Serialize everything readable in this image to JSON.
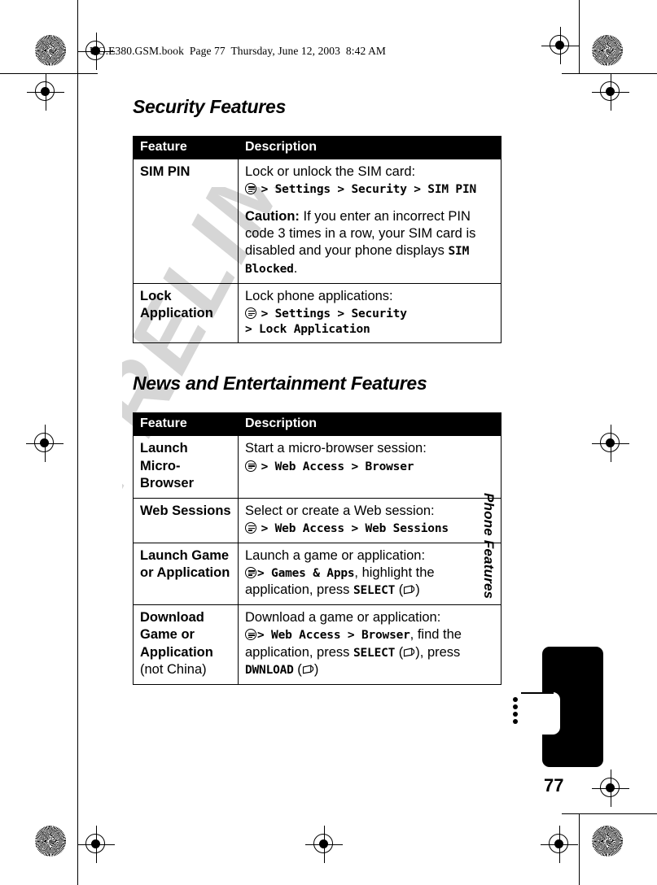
{
  "document": {
    "file_info": "UG.E380.GSM.book  Page 77  Thursday, June 12, 2003  8:42 AM",
    "watermark": "PRELIMINARY",
    "page_number": "77",
    "chapter_tab": "Phone Features"
  },
  "sections": [
    {
      "heading": "Security Features",
      "table": {
        "columns": [
          "Feature",
          "Description"
        ],
        "rows": [
          {
            "feature": "SIM PIN",
            "description_line1": "Lock or unlock the SIM card:",
            "path": "> Settings > Security > SIM PIN",
            "note_label": "Caution:",
            "note_text": " If you enter an incorrect PIN code 3 times in a row, your SIM card is disabled and your phone displays ",
            "note_mono": "SIM Blocked",
            "note_tail": "."
          },
          {
            "feature": "Lock Application",
            "description_line1": "Lock phone applications:",
            "path": "> Settings > Security",
            "path2": "> Lock Application"
          }
        ]
      }
    },
    {
      "heading": "News and Entertainment Features",
      "table": {
        "columns": [
          "Feature",
          "Description"
        ],
        "rows": [
          {
            "feature": "Launch Micro-Browser",
            "description_line1": "Start a micro-browser session:",
            "path": "> Web Access > Browser"
          },
          {
            "feature": "Web Sessions",
            "description_line1": "Select or create a Web session:",
            "path": "> Web Access > Web Sessions"
          },
          {
            "feature": "Launch Game or Application",
            "description_line1": "Launch a game or application:",
            "path": "> Games & Apps",
            "path_tail": ", highlight the application, press ",
            "key_label": "SELECT",
            "key_close": ")"
          },
          {
            "feature": "Download Game or Application",
            "feature_note": "(not China)",
            "description_line1": "Download a game or application:",
            "path": "> Web Access > Browser",
            "path_tail": ", find the application, press ",
            "key_label": "SELECT",
            "key_mid": "), press ",
            "key_label2": "DWNLOAD",
            "key_close": ")"
          }
        ]
      }
    }
  ],
  "icons": {
    "menu": "menu-circle-icon",
    "softkey": "soft-key-icon"
  },
  "colors": {
    "header_bg": "#000000",
    "header_fg": "#ffffff",
    "watermark": "#d6d6d6"
  }
}
